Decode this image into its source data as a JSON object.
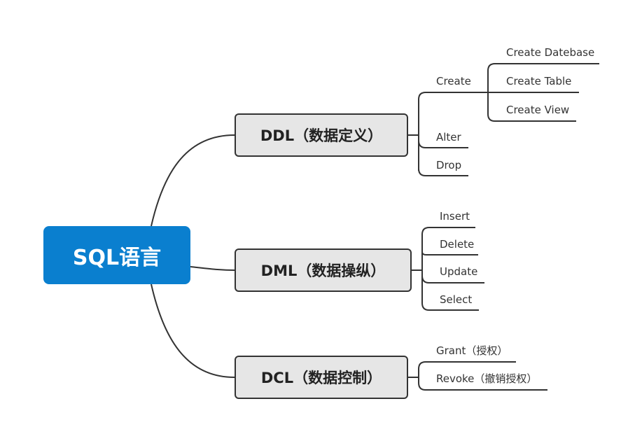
{
  "diagram": {
    "root": {
      "label": "SQL语言"
    },
    "categories": {
      "ddl": {
        "label": "DDL（数据定义）",
        "children": {
          "create": {
            "label": "Create",
            "children": [
              "Create Datebase",
              "Create Table",
              "Create View"
            ]
          },
          "alter": {
            "label": "Alter"
          },
          "drop": {
            "label": "Drop"
          }
        }
      },
      "dml": {
        "label": "DML（数据操纵）",
        "children": [
          "Insert",
          "Delete",
          "Update",
          "Select"
        ]
      },
      "dcl": {
        "label": "DCL（数据控制）",
        "children": [
          "Grant（授权）",
          "Revoke（撤销授权）"
        ]
      }
    },
    "colors": {
      "root_fill": "#0a7fcf",
      "category_fill": "#e6e6e6",
      "line": "#333333",
      "text": "#333333"
    }
  }
}
